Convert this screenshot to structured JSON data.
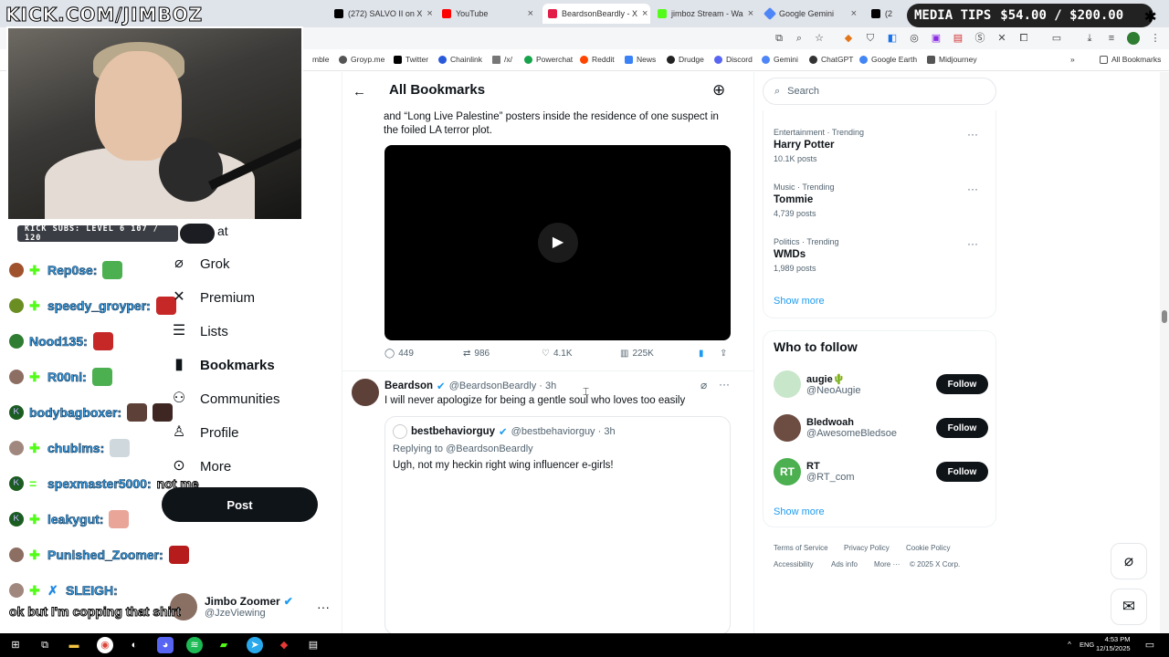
{
  "browser": {
    "tabs": [
      {
        "label": "(272) SALVO II on X"
      },
      {
        "label": "YouTube"
      },
      {
        "label": "BeardsonBeardly - X"
      },
      {
        "label": "jimboz Stream - Wa"
      },
      {
        "label": "Google Gemini"
      },
      {
        "label": "(2"
      }
    ],
    "bookmarks": [
      "mble",
      "Groyp.me",
      "Twitter",
      "Chainlink",
      "/x/",
      "Powerchat",
      "Reddit",
      "News",
      "Drudge",
      "Discord",
      "Gemini",
      "ChatGPT",
      "Google Earth",
      "Midjourney"
    ],
    "all_bookmarks": "All Bookmarks"
  },
  "stream": {
    "channel": "KICK.COM/JIMBOZ",
    "media_tips": "MEDIA TIPS",
    "tips_amount": "$54.00 / $200.00",
    "kick_subs": "KICK SUBS: LEVEL 6 107 / 120",
    "overlay_caption": "ok but I'm copping that shirt",
    "chat": [
      {
        "user": "Rep0se:"
      },
      {
        "user": "speedy_groyper:"
      },
      {
        "user": "Nood135:"
      },
      {
        "user": "R00ni:"
      },
      {
        "user": "bodybagboxer:"
      },
      {
        "user": "chubims:"
      },
      {
        "user": "spexmaster5000:",
        "message": "not me"
      },
      {
        "user": "leakygut:"
      },
      {
        "user": "Punished_Zoomer:"
      },
      {
        "user": "SLEIGH:"
      }
    ]
  },
  "nav": {
    "partial": "at",
    "items": [
      "Grok",
      "Premium",
      "Lists",
      "Bookmarks",
      "Communities",
      "Profile",
      "More"
    ],
    "post": "Post",
    "profile_name": "Jimbo Zoomer",
    "profile_handle": "@JzeViewing"
  },
  "bookmarks_page": {
    "title": "All Bookmarks",
    "tweet1_text_1": "and “Long Live Palestine” posters inside the residence of one suspect in",
    "tweet1_text_2": "the foiled LA terror plot.",
    "tweet1_stats": {
      "replies": "449",
      "reposts": "986",
      "likes": "4.1K",
      "views": "225K"
    },
    "tweet2_author": "Beardson",
    "tweet2_handle": "@BeardsonBeardly · 3h",
    "tweet2_text": "I will never apologize for being a gentle soul who loves too easily",
    "quote_author": "bestbehaviorguy",
    "quote_handle": "@bestbehaviorguy · 3h",
    "quote_reply": "Replying to @BeardsonBeardly",
    "quote_text": "Ugh, not my heckin right wing influencer e-girls!"
  },
  "sidebar": {
    "search_placeholder": "Search",
    "trends": [
      {
        "category": "Entertainment · Trending",
        "name": "Harry Potter",
        "count": "10.1K posts"
      },
      {
        "category": "Music · Trending",
        "name": "Tommie",
        "count": "4,739 posts"
      },
      {
        "category": "Politics · Trending",
        "name": "WMDs",
        "count": "1,989 posts"
      }
    ],
    "show_more": "Show more",
    "who_to_follow": "Who to follow",
    "follow": [
      {
        "name": "augie🌵",
        "handle": "@NeoAugie",
        "button": "Follow"
      },
      {
        "name": "Bledwoah",
        "handle": "@AwesomeBledsoe",
        "button": "Follow"
      },
      {
        "name": "RT",
        "handle": "@RT_com",
        "button": "Follow"
      }
    ],
    "show_more_2": "Show more",
    "footer": [
      "Terms of Service",
      "Privacy Policy",
      "Cookie Policy",
      "Accessibility",
      "Ads info",
      "More ···",
      "© 2025 X Corp."
    ]
  },
  "taskbar": {
    "lang": "ENG",
    "time": "4:53 PM",
    "date": "12/15/2025"
  }
}
